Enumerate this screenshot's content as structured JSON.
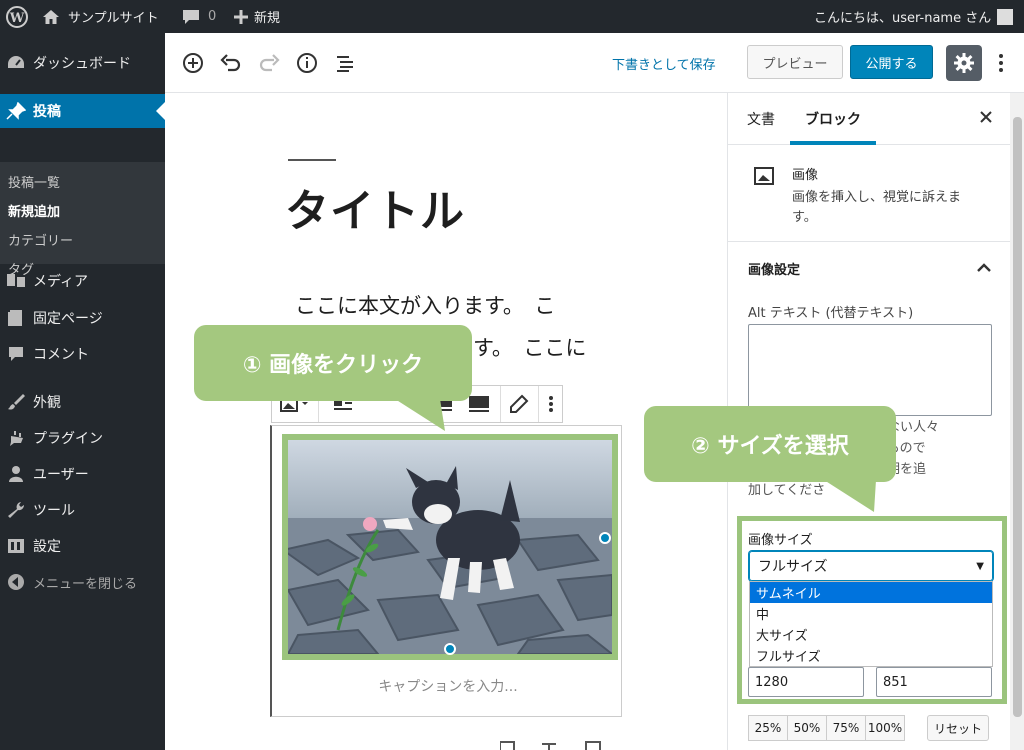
{
  "admin_bar": {
    "site_name": "サンプルサイト",
    "comments_count": "0",
    "new_label": "新規",
    "greeting": "こんにちは、user-name さん"
  },
  "sidebar": {
    "items": [
      {
        "label": "ダッシュボード",
        "icon": "dashboard-icon"
      },
      {
        "label": "投稿",
        "icon": "pin-icon"
      },
      {
        "label": "メディア",
        "icon": "media-icon"
      },
      {
        "label": "固定ページ",
        "icon": "page-icon"
      },
      {
        "label": "コメント",
        "icon": "comment-icon"
      },
      {
        "label": "外観",
        "icon": "brush-icon"
      },
      {
        "label": "プラグイン",
        "icon": "plugin-icon"
      },
      {
        "label": "ユーザー",
        "icon": "user-icon"
      },
      {
        "label": "ツール",
        "icon": "wrench-icon"
      },
      {
        "label": "設定",
        "icon": "settings-icon"
      },
      {
        "label": "メニューを閉じる",
        "icon": "collapse-icon"
      }
    ],
    "submenu": [
      "投稿一覧",
      "新規追加",
      "カテゴリー",
      "タグ"
    ]
  },
  "toolbar": {
    "save_draft": "下書きとして保存",
    "preview": "プレビュー",
    "publish": "公開する"
  },
  "editor": {
    "title": "タイトル",
    "paragraph_line1": "ここに本文が入ります。　こ",
    "paragraph_line2": "す。　ここに",
    "caption_placeholder": "キャプションを入力..."
  },
  "callouts": {
    "step1": "① 画像をクリック",
    "step2": "② サイズを選択"
  },
  "settings": {
    "tab_document": "文書",
    "tab_block": "ブロック",
    "block_name": "画像",
    "block_desc": "画像を挿入し、視覚に訴えます。",
    "panel_title": "画像設定",
    "alt_label": "Alt テキスト (代替テキスト)",
    "alt_value": "",
    "alt_help_line1": "見られない人々",
    "alt_help_line2": "伝えるもので",
    "alt_help_line3": "短い説明を追",
    "alt_help_line4": "加してくださ",
    "size_label": "画像サイズ",
    "size_selected": "フルサイズ",
    "size_options": [
      "サムネイル",
      "中",
      "大サイズ",
      "フルサイズ"
    ],
    "width": "1280",
    "height": "851",
    "percent_buttons": [
      "25%",
      "50%",
      "75%",
      "100%"
    ],
    "reset": "リセット"
  },
  "colors": {
    "admin_dark": "#23282d",
    "wp_blue": "#0073aa",
    "publish_blue": "#0085ba",
    "callout_green": "#a4c87f",
    "highlight_green": "#9bc47d"
  }
}
